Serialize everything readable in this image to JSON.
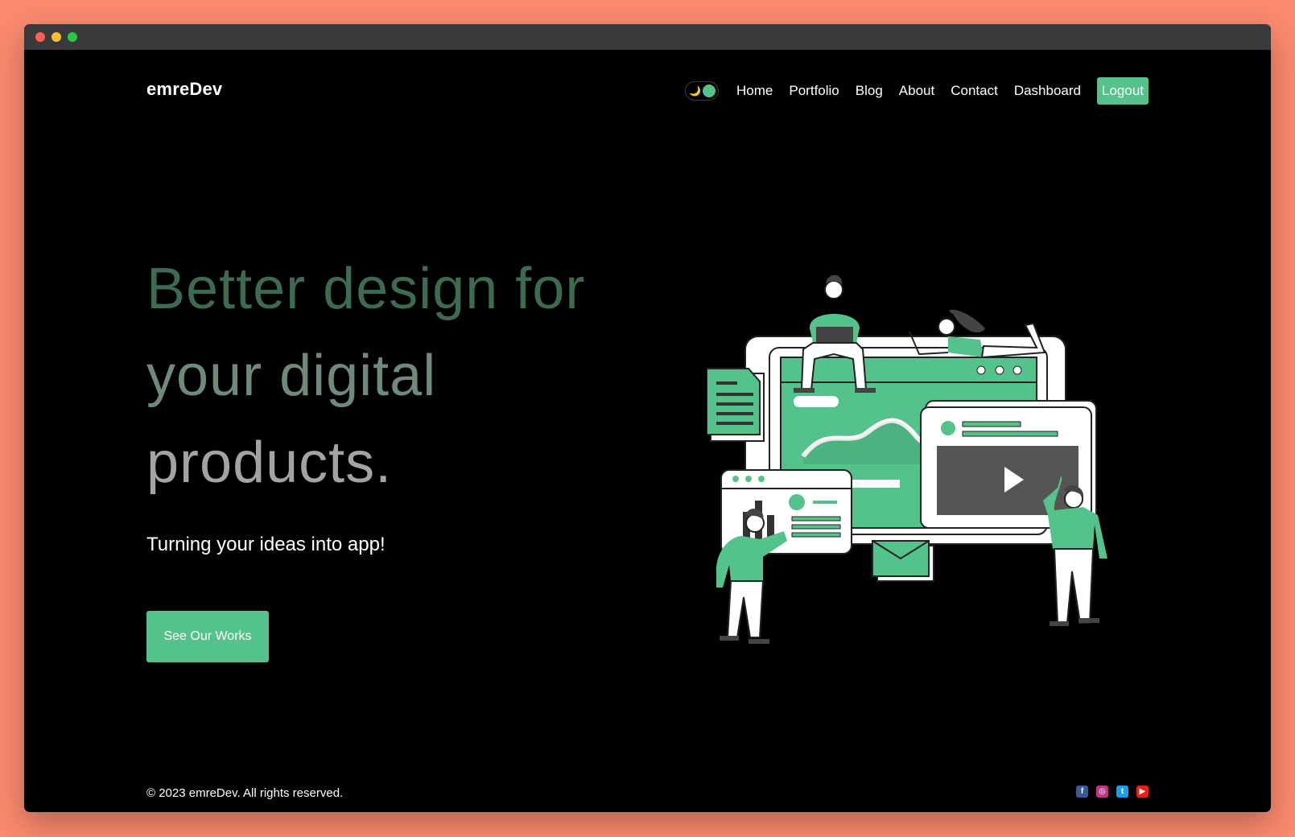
{
  "brand": "emreDev",
  "nav": {
    "theme_toggle_glyph": "🌙",
    "items": [
      "Home",
      "Portfolio",
      "Blog",
      "About",
      "Contact",
      "Dashboard"
    ],
    "logout_label": "Logout"
  },
  "hero": {
    "title_lines": [
      "Better design for",
      "your digital",
      "products."
    ],
    "tagline": "Turning your ideas into app!",
    "cta_label": "See Our Works"
  },
  "footer": {
    "copyright": "© 2023 emreDev. All rights reserved.",
    "socials": [
      {
        "name": "facebook-icon",
        "glyph": "f",
        "color": "#3b5998"
      },
      {
        "name": "instagram-icon",
        "glyph": "◎",
        "color": "#c13584"
      },
      {
        "name": "twitter-icon",
        "glyph": "t",
        "color": "#1d9bf0"
      },
      {
        "name": "youtube-icon",
        "glyph": "▶",
        "color": "#e62117"
      }
    ]
  },
  "colors": {
    "accent": "#53c28b",
    "background": "#000000",
    "page_backdrop": "#fb8a6e"
  }
}
